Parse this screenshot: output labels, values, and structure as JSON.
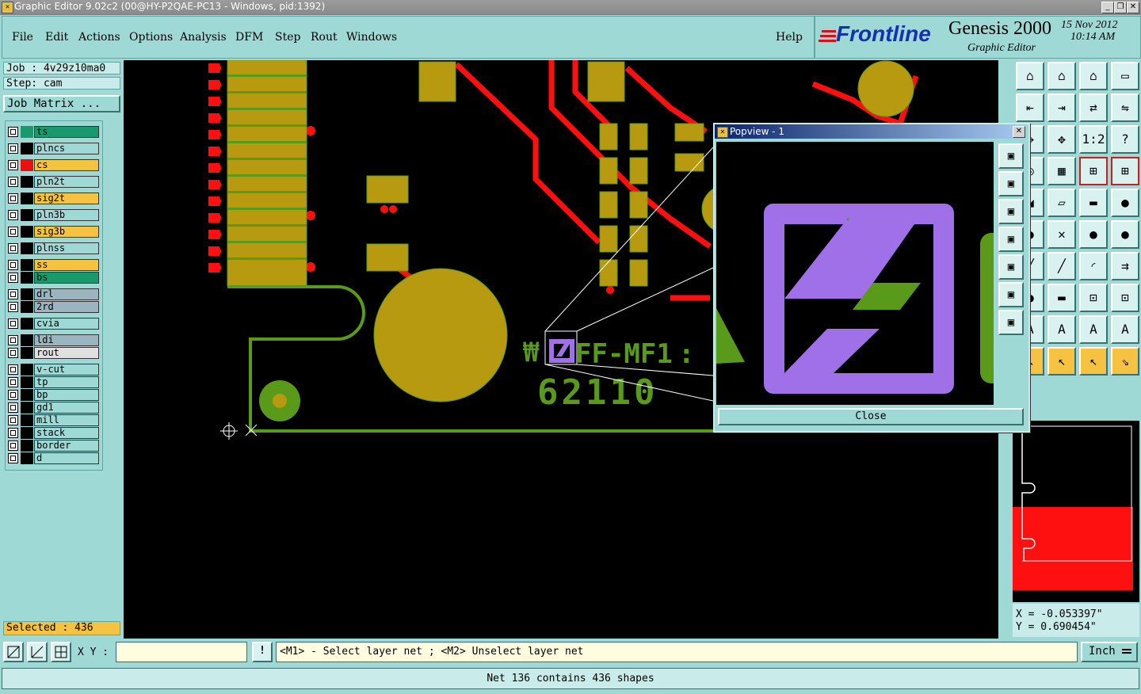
{
  "window": {
    "title": "Graphic Editor 9.02c2 (00@HY-P2QAE-PC13 - Windows, pid:1392)"
  },
  "menu": [
    "File",
    "Edit",
    "Actions",
    "Options",
    "Analysis",
    "DFM",
    "Step",
    "Rout",
    "Windows"
  ],
  "help_label": "Help",
  "brand": {
    "logo": "Frontline",
    "product": "Genesis 2000",
    "subtitle": "Graphic Editor",
    "date": "15 Nov 2012",
    "time": "10:14 AM"
  },
  "job": {
    "job_label": "Job : 4v29z10ma0",
    "step_label": "Step: cam",
    "matrix_button": "Job Matrix ..."
  },
  "layers": [
    {
      "name": "ts",
      "color": "#1a9a6c",
      "swatch": "#1a9a6c"
    },
    {
      "name": "plncs",
      "color": "#9fd9d6",
      "swatch": "#000000"
    },
    {
      "name": "cs",
      "color": "#f5c242",
      "swatch": "#e81010"
    },
    {
      "name": "pln2t",
      "color": "#9fd9d6",
      "swatch": "#000000"
    },
    {
      "name": "sig2t",
      "color": "#f5c242",
      "swatch": "#000000"
    },
    {
      "name": "pln3b",
      "color": "#9fd9d6",
      "swatch": "#000000"
    },
    {
      "name": "sig3b",
      "color": "#f5c242",
      "swatch": "#000000"
    },
    {
      "name": "plnss",
      "color": "#9fd9d6",
      "swatch": "#000000"
    },
    {
      "name": "ss",
      "color": "#f5c242",
      "swatch": "#000000"
    },
    {
      "name": "bs",
      "color": "#1a9a6c",
      "swatch": "#000000"
    },
    {
      "name": "drl",
      "color": "#9ab4c0",
      "swatch": "#000000"
    },
    {
      "name": "2rd",
      "color": "#9ab4c0",
      "swatch": "#000000"
    },
    {
      "name": "cvia",
      "color": "#9fd9d6",
      "swatch": "#000000"
    },
    {
      "name": "ldi",
      "color": "#9ab4c0",
      "swatch": "#000000"
    },
    {
      "name": "rout",
      "color": "#e0e0e0",
      "swatch": "#000000"
    },
    {
      "name": "v-cut",
      "color": "#9fd9d6",
      "swatch": "#000000"
    },
    {
      "name": "tp",
      "color": "#9fd9d6",
      "swatch": "#000000"
    },
    {
      "name": "bp",
      "color": "#9fd9d6",
      "swatch": "#000000"
    },
    {
      "name": "gd1",
      "color": "#9fd9d6",
      "swatch": "#000000"
    },
    {
      "name": "mill",
      "color": "#9fd9d6",
      "swatch": "#000000"
    },
    {
      "name": "stack",
      "color": "#9fd9d6",
      "swatch": "#000000"
    },
    {
      "name": "border",
      "color": "#9fd9d6",
      "swatch": "#000000"
    },
    {
      "name": "d",
      "color": "#9fd9d6",
      "swatch": "#000000"
    }
  ],
  "selected_label": "Selected : 436",
  "canvas_text": {
    "part_label": "FF-MF1",
    "number_label": "62110"
  },
  "popview": {
    "title": "Popview - 1",
    "close_button": "Close"
  },
  "xy": {
    "label": "X Y :",
    "value": ""
  },
  "prompt": "<M1> - Select layer net ; <M2> Unselect layer net",
  "units": "Inch",
  "coords": {
    "x": "X = -0.053397\"",
    "y": "Y = 0.690454\""
  },
  "status_text": "Net 136 contains 436 shapes"
}
